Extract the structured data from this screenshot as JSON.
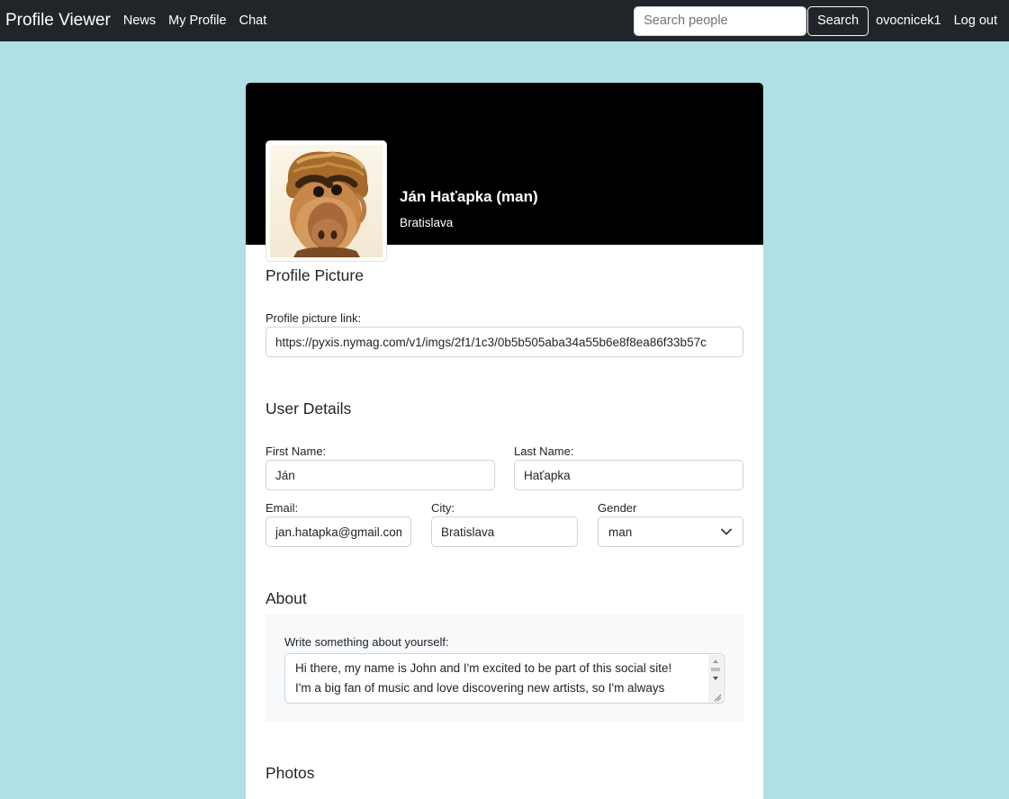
{
  "navbar": {
    "brand": "Profile Viewer",
    "links": [
      "News",
      "My Profile",
      "Chat"
    ],
    "search_placeholder": "Search people",
    "search_button": "Search",
    "username": "ovocnicek1",
    "logout": "Log out"
  },
  "profile": {
    "name": "Ján Haťapka (man)",
    "city": "Bratislava"
  },
  "picture_section": {
    "title": "Profile Picture",
    "link_label": "Profile picture link:",
    "link_value": "https://pyxis.nymag.com/v1/imgs/2f1/1c3/0b5b505aba34a55b6e8f8ea86f33b57c"
  },
  "details_section": {
    "title": "User Details",
    "first_name_label": "First Name:",
    "first_name_value": "Ján",
    "last_name_label": "Last Name:",
    "last_name_value": "Haťapka",
    "email_label": "Email:",
    "email_value": "jan.hatapka@gmail.com",
    "city_label": "City:",
    "city_value": "Bratislava",
    "gender_label": "Gender",
    "gender_value": "man"
  },
  "about_section": {
    "title": "About",
    "prompt_label": "Write something about yourself:",
    "line1": "Hi there, my name is John and I'm excited to be part of this social site!",
    "line2": "I'm a big fan of music and love discovering new artists, so I'm always"
  },
  "photos_section": {
    "title": "Photos"
  },
  "colors": {
    "background": "#b0dfe5",
    "navbar": "#212529",
    "cover": "#000000"
  }
}
